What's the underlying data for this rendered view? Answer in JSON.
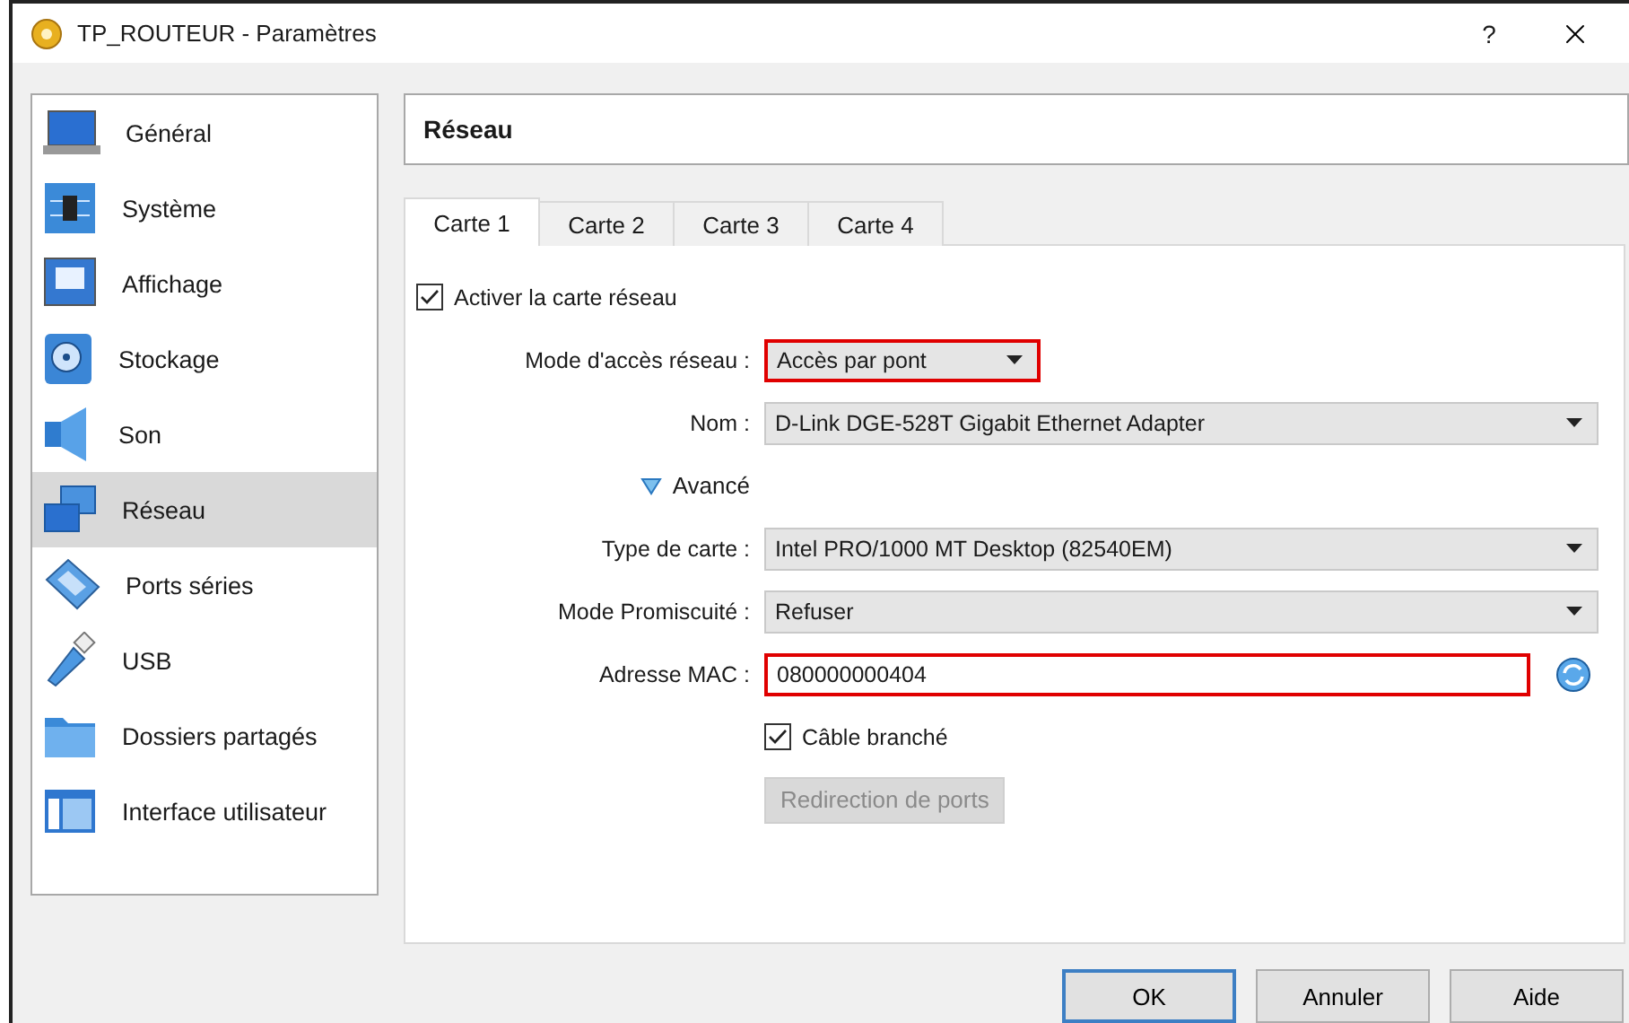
{
  "window": {
    "title": "TP_ROUTEUR - Paramètres",
    "help": "?"
  },
  "sidebar": {
    "items": [
      {
        "label": "Général",
        "selected": false
      },
      {
        "label": "Système",
        "selected": false
      },
      {
        "label": "Affichage",
        "selected": false
      },
      {
        "label": "Stockage",
        "selected": false
      },
      {
        "label": "Son",
        "selected": false
      },
      {
        "label": "Réseau",
        "selected": true
      },
      {
        "label": "Ports séries",
        "selected": false
      },
      {
        "label": "USB",
        "selected": false
      },
      {
        "label": "Dossiers partagés",
        "selected": false
      },
      {
        "label": "Interface utilisateur",
        "selected": false
      }
    ]
  },
  "section_title": "Réseau",
  "tabs": [
    {
      "label": "Carte 1",
      "selected": true
    },
    {
      "label": "Carte 2",
      "selected": false
    },
    {
      "label": "Carte 3",
      "selected": false
    },
    {
      "label": "Carte 4",
      "selected": false
    }
  ],
  "form": {
    "enable_adapter": {
      "label": "Activer la carte réseau",
      "checked": true
    },
    "attached_to": {
      "label": "Mode d'accès réseau :",
      "value": "Accès par pont",
      "highlighted": true
    },
    "name": {
      "label": "Nom :",
      "value": "D-Link DGE-528T Gigabit Ethernet Adapter",
      "highlighted": false
    },
    "advanced": {
      "label": "Avancé",
      "expanded": true
    },
    "adapter_type": {
      "label": "Type de carte :",
      "value": "Intel PRO/1000 MT Desktop (82540EM)",
      "highlighted": false
    },
    "promiscuous": {
      "label": "Mode Promiscuité :",
      "value": "Refuser",
      "highlighted": false
    },
    "mac": {
      "label": "Adresse MAC :",
      "value": "080000000404",
      "highlighted": true
    },
    "cable": {
      "label": "Câble branché",
      "checked": true
    },
    "port_forwarding": {
      "label": "Redirection de ports",
      "disabled": true
    }
  },
  "buttons": [
    {
      "label": "OK",
      "default": true
    },
    {
      "label": "Annuler",
      "default": false
    },
    {
      "label": "Aide",
      "default": false
    }
  ]
}
